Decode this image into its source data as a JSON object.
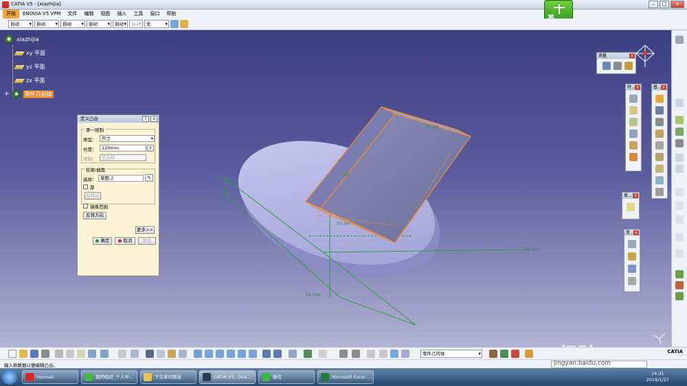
{
  "window": {
    "title": "CATIA V5 - [xiazhijia]"
  },
  "menu": [
    "开始",
    "ENOVIA V5 VPM",
    "文件",
    "编辑",
    "视图",
    "插入",
    "工具",
    "窗口",
    "帮助"
  ],
  "propbar": {
    "combos": [
      "自动",
      "自动",
      "自动",
      "自动",
      "自动",
      "自动",
      "无"
    ]
  },
  "tree": {
    "root": "xiazhijia",
    "items": [
      "xy 平面",
      "yz 平面",
      "zx 平面"
    ],
    "part_body": "零件几何体"
  },
  "dialog": {
    "title": "定义凸台",
    "first_limit_group": "第一限制",
    "type_label": "类型：",
    "type_value": "尺寸",
    "length_label": "长度：",
    "length_value": "120mm",
    "limit_label": "限制：",
    "limit_value": "无选择",
    "profile_group": "轮廓/曲面",
    "select_label": "选择：",
    "select_value": "草图.2",
    "thick_label": "厚",
    "reverse_side_label": "反转边",
    "mirror_label": "镜像范围",
    "reverse_dir_label": "反转方向",
    "more_label": "更多>>",
    "ok_label": "确定",
    "cancel_label": "取消",
    "preview_label": "预览"
  },
  "floatbars": {
    "measure": "测量",
    "feature": "特...",
    "solid": "基...",
    "sketch": "草...",
    "transform": "变..."
  },
  "viewport_labels": {
    "dim_120": "120",
    "dim_left": "25.892",
    "dim_right": "20.018",
    "dim_bottom": "18.068",
    "dim_top": "90.98",
    "dim_mid": "90.98"
  },
  "bottom_combo": "零件几何体",
  "status": {
    "text": "输入新数据以便编辑凸台。"
  },
  "taskbar": {
    "tasks": [
      "Foxmail",
      "我的经验_个人中...",
      "下交革的图连",
      "CATIA V5 - [xia...",
      "微信",
      "Microsoft Excel ..."
    ],
    "time": "14:31",
    "date": "2019/1/27"
  },
  "ime": "英",
  "watermark": {
    "brand": "Bai 经验",
    "url": "jingyan.baidu.com"
  },
  "catia_corner": "CATIA",
  "colors": {
    "accent": "#f08a2b",
    "viewport_top": "#3d3f83",
    "viewport_bottom": "#b3b3d3"
  }
}
